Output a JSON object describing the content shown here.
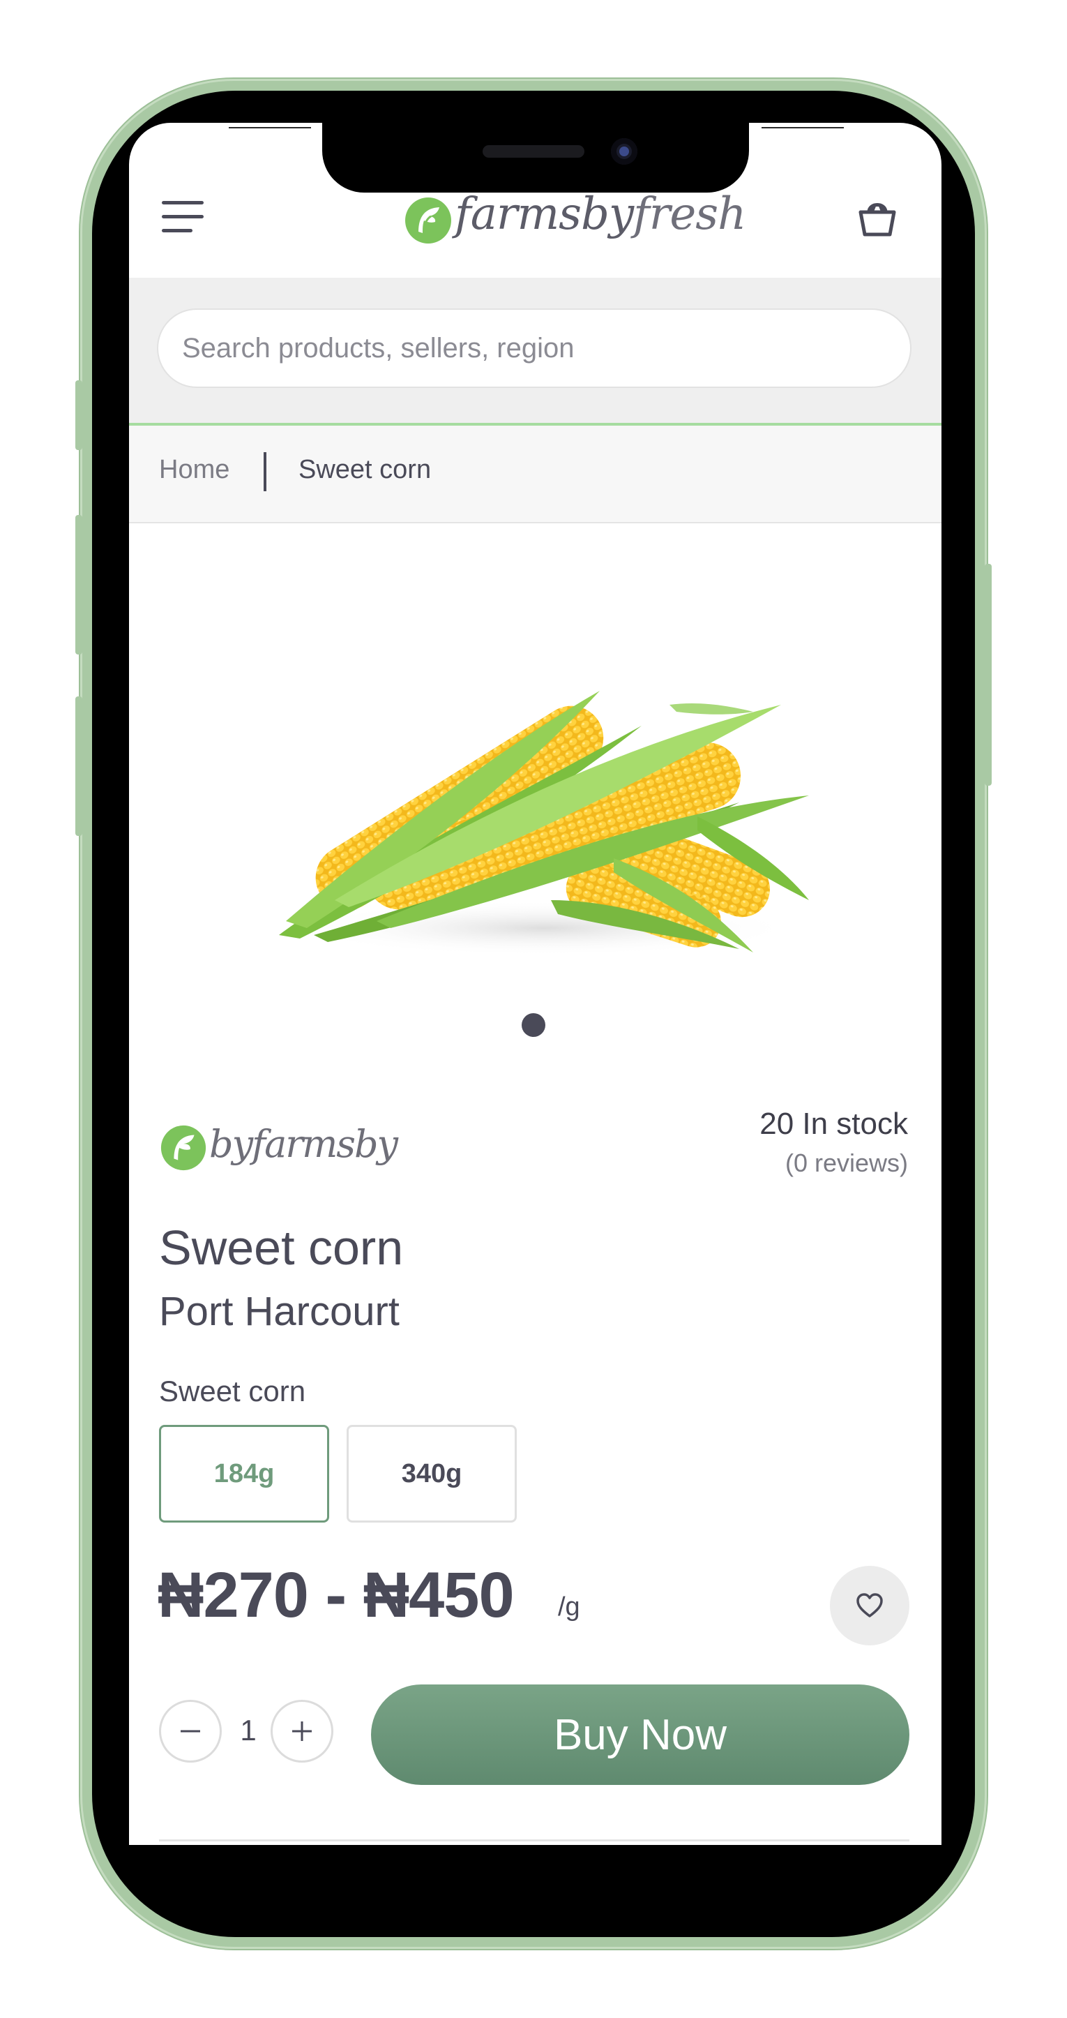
{
  "app": {
    "brand_name": "farmsbyfresh",
    "brand_part_1": "farmsby",
    "brand_part_2": "fresh",
    "accent_color": "#6f9b7c"
  },
  "search": {
    "placeholder": "Search products, sellers, region"
  },
  "breadcrumb": {
    "home": "Home",
    "current": "Sweet corn"
  },
  "gallery": {
    "image_subject": "Sweet corn cobs",
    "slide_count": 1,
    "active_slide": 1
  },
  "seller": {
    "name": "by farmsby",
    "name_part_1": "by",
    "name_part_2": "farmsby"
  },
  "stock": {
    "text": "20 In stock",
    "reviews": "(0 reviews)"
  },
  "product": {
    "name": "Sweet corn",
    "location": "Port Harcourt",
    "variant_label": "Sweet corn",
    "variants": [
      {
        "label": "184g",
        "selected": true
      },
      {
        "label": "340g",
        "selected": false
      }
    ],
    "price": "₦270 - ₦450",
    "unit": "/g"
  },
  "purchase": {
    "quantity": "1",
    "buy_label": "Buy Now"
  },
  "icons": {
    "menu": "hamburger-menu-icon",
    "cart": "shopping-bag-icon",
    "favorite": "heart-icon",
    "minus": "minus-icon",
    "plus": "plus-icon"
  }
}
